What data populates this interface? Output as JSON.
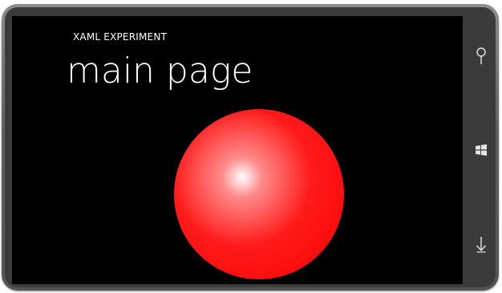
{
  "app": {
    "title": "XAML EXPERIMENT",
    "page_title": "main page"
  },
  "content": {
    "sphere_colors": {
      "highlight": "#ffffff",
      "base": "#ff0000"
    }
  },
  "hardware_buttons": [
    {
      "icon": "search-icon"
    },
    {
      "icon": "windows-start-icon"
    },
    {
      "icon": "arrow-down-icon"
    }
  ],
  "colors": {
    "screen_background": "#000000",
    "text": "#ffffff",
    "device_frame": "#5f5f5f"
  }
}
